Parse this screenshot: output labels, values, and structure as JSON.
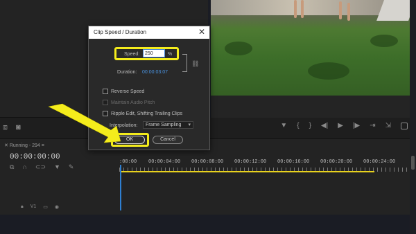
{
  "dialog": {
    "title": "Clip Speed / Duration",
    "close_glyph": "✕",
    "speed_label": "Speed:",
    "speed_value": "250",
    "speed_unit": "%",
    "duration_label": "Duration:",
    "duration_value": "00:00:03:07",
    "link_icon": "chain-link-icon",
    "checkboxes": [
      {
        "label": "Reverse Speed",
        "checked": false,
        "enabled": true
      },
      {
        "label": "Maintain Audio Pitch",
        "checked": false,
        "enabled": false
      },
      {
        "label": "Ripple Edit, Shifting Trailing Clips",
        "checked": false,
        "enabled": true
      }
    ],
    "interpolation_label": "Interpolation:",
    "interpolation_value": "Frame Sampling",
    "ok_label": "OK",
    "cancel_label": "Cancel"
  },
  "timeline": {
    "sequence_tab": "Running - 294",
    "timecode": "00:00:00:00",
    "ruler_labels": [
      ":00:00",
      "00:00:04:00",
      "00:00:08:00",
      "00:00:12:00",
      "00:00:16:00",
      "00:00:20:00",
      "00:00:24:00"
    ]
  },
  "colors": {
    "highlight": "#f4ec1c",
    "accent_blue": "#4a93e0",
    "timeline_bar": "#e8d21d"
  }
}
